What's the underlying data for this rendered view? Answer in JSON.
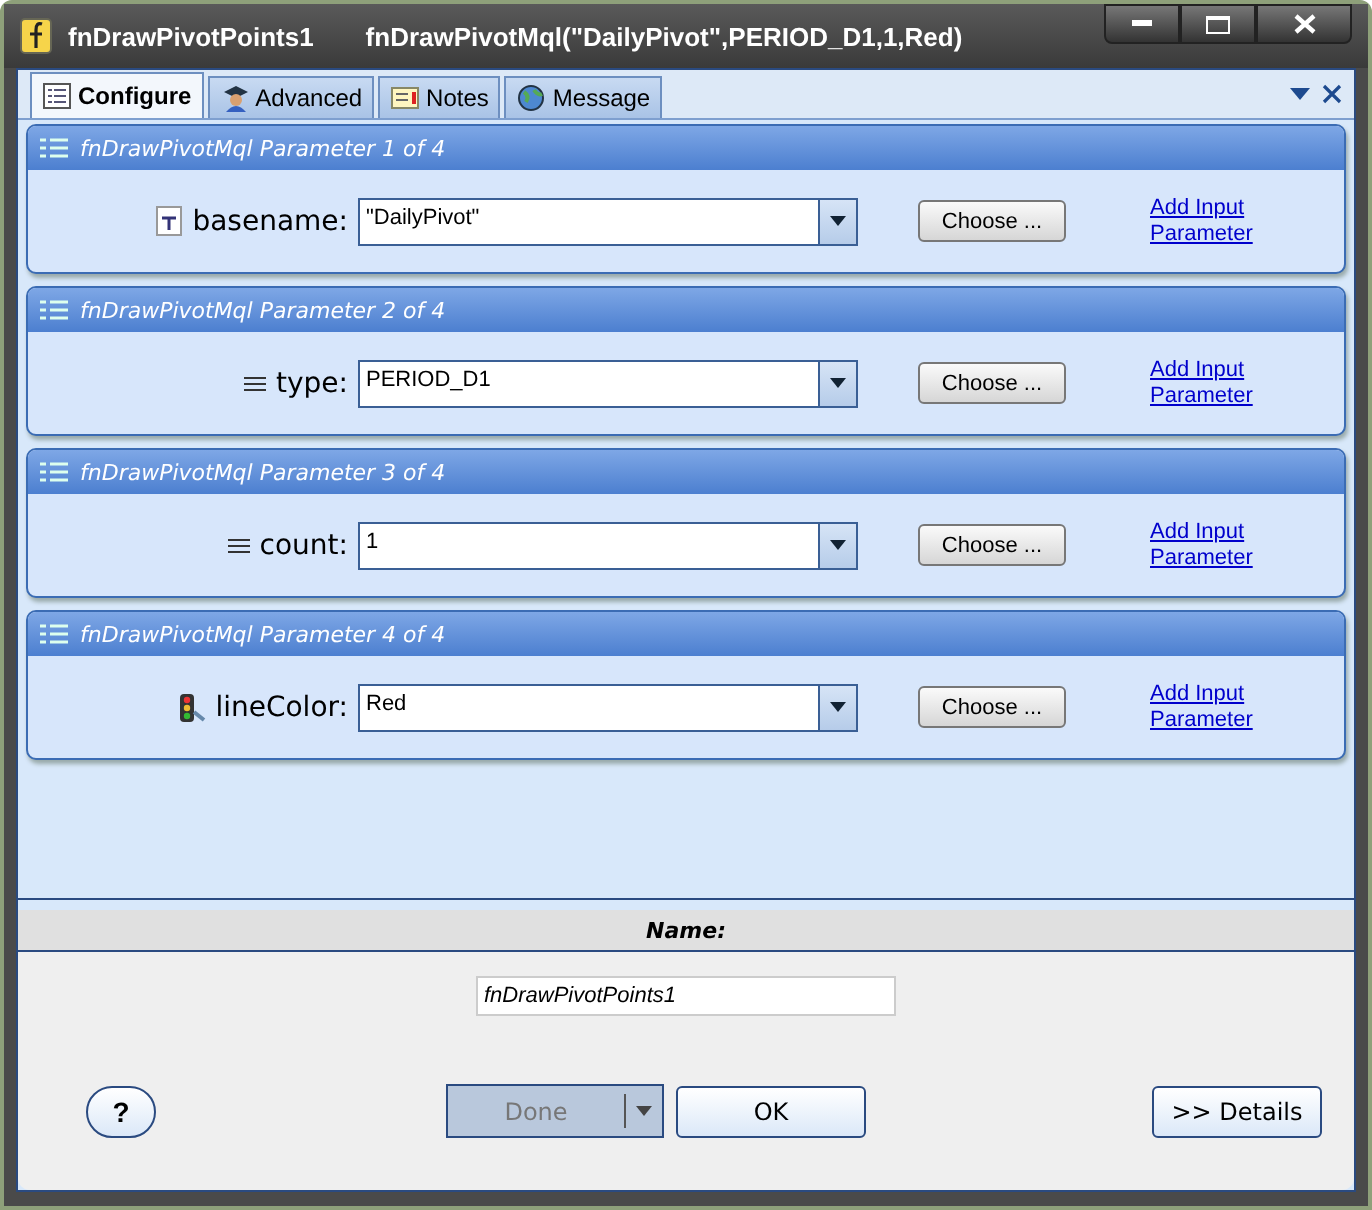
{
  "window": {
    "title": "fnDrawPivotPoints1",
    "subtitle": "fnDrawPivotMql(\"DailyPivot\",PERIOD_D1,1,Red)"
  },
  "tabs": [
    {
      "label": "Configure",
      "selected": true,
      "kind": "configure"
    },
    {
      "label": "Advanced",
      "selected": false,
      "kind": "advanced"
    },
    {
      "label": "Notes",
      "selected": false,
      "kind": "notes"
    },
    {
      "label": "Message",
      "selected": false,
      "kind": "message"
    }
  ],
  "parameters": [
    {
      "header": "fnDrawPivotMql Parameter 1 of 4",
      "label": "basename:",
      "kind": "text",
      "value": "\"DailyPivot\"",
      "choose": "Choose ...",
      "link": "Add Input Parameter"
    },
    {
      "header": "fnDrawPivotMql Parameter 2 of 4",
      "label": "type:",
      "kind": "list",
      "value": "PERIOD_D1",
      "choose": "Choose ...",
      "link": "Add Input Parameter"
    },
    {
      "header": "fnDrawPivotMql Parameter 3 of 4",
      "label": "count:",
      "kind": "list",
      "value": "1",
      "choose": "Choose ...",
      "link": "Add Input Parameter"
    },
    {
      "header": "fnDrawPivotMql Parameter 4 of 4",
      "label": "lineColor:",
      "kind": "color",
      "value": "Red",
      "choose": "Choose ...",
      "link": "Add Input Parameter"
    }
  ],
  "name_section": {
    "header": "Name:",
    "value": "fnDrawPivotPoints1"
  },
  "buttons": {
    "help": "?",
    "done": {
      "label": "Done",
      "disabled": true
    },
    "ok": "OK",
    "details": ">> Details"
  }
}
